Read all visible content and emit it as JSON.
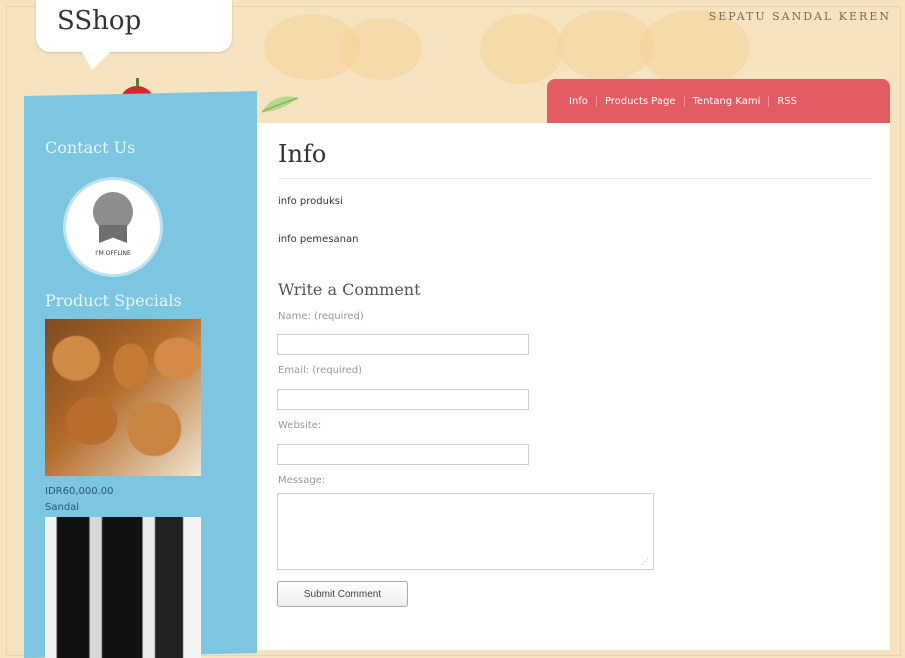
{
  "site": {
    "logo": "SShop",
    "tagline": "SEPATU SANDAL KEREN"
  },
  "nav": {
    "items": [
      "Info",
      "Products Page",
      "Tentang Kami",
      "RSS"
    ]
  },
  "sidebar": {
    "contact_title": "Contact Us",
    "status_text": "I'M OFFLINE",
    "products_title": "Product Specials",
    "product_1": {
      "price": "IDR60,000.00",
      "name": "Sandal"
    }
  },
  "main": {
    "title": "Info",
    "paragraph_1": "info produksi",
    "paragraph_2": "info pemesanan",
    "comment_title": "Write a Comment",
    "name_label": "Name: (required)",
    "email_label": "Email: (required)",
    "website_label": "Website:",
    "message_label": "Message:",
    "submit_label": "Submit Comment"
  },
  "colors": {
    "nav_bg": "#e35b63",
    "sidebar_bg": "#7cc6e1",
    "page_bg": "#f6e4c0"
  }
}
